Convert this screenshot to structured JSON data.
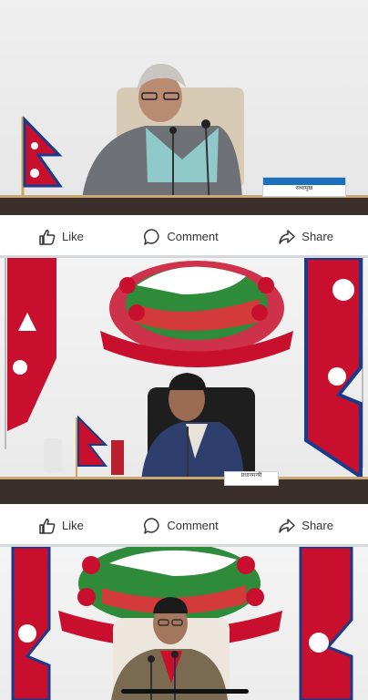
{
  "posts": [
    {
      "image_alt": "Woman seated at desk with microphones and Nepal flag",
      "name_plate": "सभामुख",
      "actions": {
        "like": "Like",
        "comment": "Comment",
        "share": "Share"
      }
    },
    {
      "image_alt": "Man seated in front of Nepal emblem with flags",
      "name_plate": "प्रधानमन्त्री",
      "actions": {
        "like": "Like",
        "comment": "Comment",
        "share": "Share"
      }
    },
    {
      "image_alt": "Man seated in front of Nepal emblem with flags"
    }
  ],
  "icons": {
    "like": "thumbs-up-icon",
    "comment": "speech-bubble-icon",
    "share": "share-arrow-icon"
  },
  "colors": {
    "crimson": "#c8102e",
    "navy": "#1a3a8a",
    "text": "#333333",
    "divider": "#d6d9dc"
  }
}
